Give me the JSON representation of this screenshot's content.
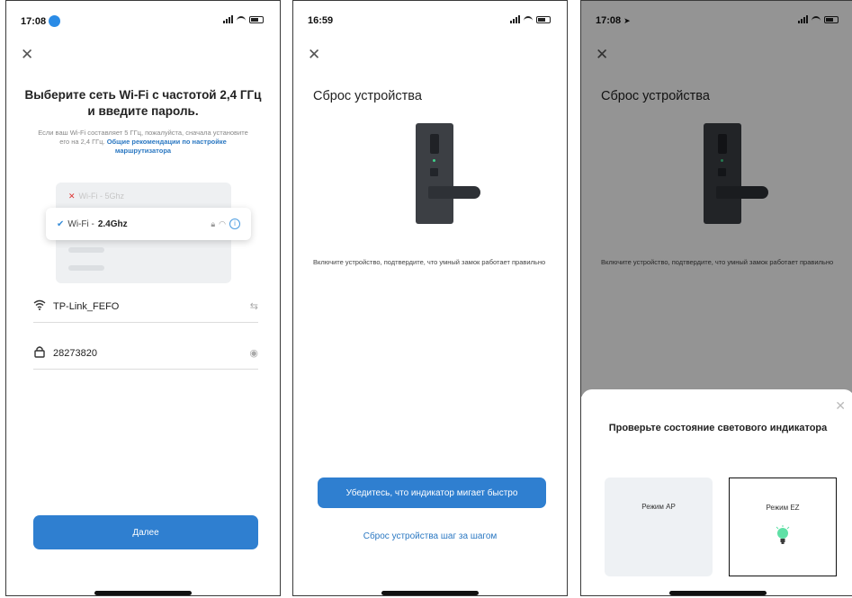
{
  "screen1": {
    "time": "17:08",
    "title": "Выберите сеть Wi-Fi с частотой 2,4 ГГц и введите пароль.",
    "description": "Если ваш Wi-Fi составляет 5 ГГц, пожалуйста, сначала установите его на 2,4 ГГц.",
    "description_link": "Общие рекомендации по настройке маршрутизатора",
    "networks": [
      {
        "label": "Wi-Fi - 5Ghz",
        "state": "unsupported"
      },
      {
        "prefix": "Wi-Fi - ",
        "band": "2.4Ghz",
        "state": "selected"
      }
    ],
    "ssid_value": "TP-Link_FEFO",
    "password_value": "28273820",
    "next_button": "Далее"
  },
  "screen2": {
    "time": "16:59",
    "title": "Сброс устройства",
    "instruction": "Включите устройство, подтвердите, что умный замок работает правильно",
    "primary_button": "Убедитесь, что индикатор мигает быстро",
    "secondary_link": "Сброс устройства шаг за шагом"
  },
  "screen3": {
    "time": "17:08",
    "title": "Сброс устройства",
    "instruction": "Включите устройство, подтвердите, что умный замок работает правильно",
    "sheet_title": "Проверьте состояние светового индикатора",
    "mode_ap": "Режим AP",
    "mode_ez": "Режим EZ"
  },
  "colors": {
    "accent": "#2f7fd0",
    "link": "#2b78c2",
    "led_green": "#3fd28a"
  }
}
